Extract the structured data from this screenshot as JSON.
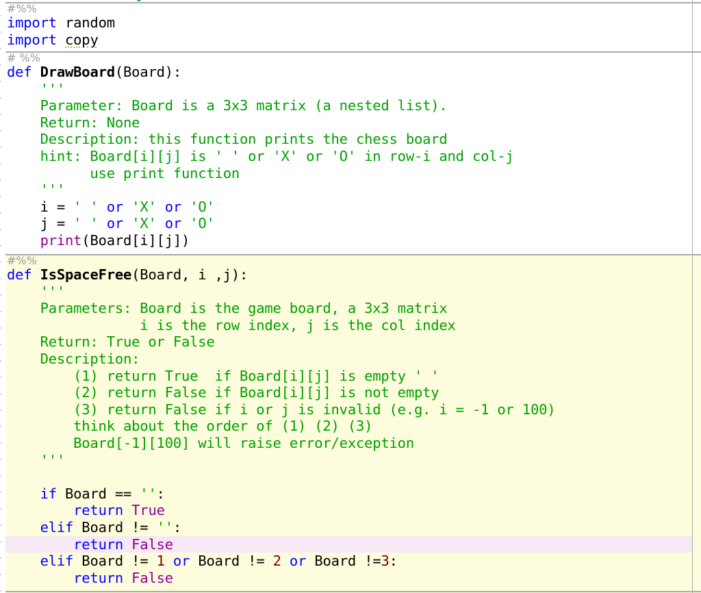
{
  "editor": {
    "language": "python",
    "cells": [
      {
        "id": "cell-imports",
        "active": false,
        "marker": "#%%",
        "lines": [
          [
            {
              "t": "kw",
              "v": "import"
            },
            {
              "t": "plain",
              "v": " random"
            }
          ],
          [
            {
              "t": "kw",
              "v": "import"
            },
            {
              "t": "plain",
              "v": " "
            },
            {
              "t": "squiggle",
              "v": "copy"
            }
          ]
        ]
      },
      {
        "id": "cell-drawboard",
        "active": false,
        "marker": "# %%",
        "lines": [
          [
            {
              "t": "kw",
              "v": "def"
            },
            {
              "t": "plain",
              "v": " "
            },
            {
              "t": "fn",
              "v": "DrawBoard"
            },
            {
              "t": "plain",
              "v": "(Board):"
            }
          ],
          [
            {
              "t": "doc",
              "v": "    '''"
            }
          ],
          [
            {
              "t": "doc",
              "v": "    Parameter: Board is a 3x3 matrix (a nested list)."
            }
          ],
          [
            {
              "t": "doc",
              "v": "    Return: None"
            }
          ],
          [
            {
              "t": "doc",
              "v": "    Description: this function prints the chess board"
            }
          ],
          [
            {
              "t": "doc",
              "v": "    hint: Board[i][j] is ' ' or 'X' or 'O' in row-i and col-j"
            }
          ],
          [
            {
              "t": "doc",
              "v": "          use print function"
            }
          ],
          [
            {
              "t": "doc",
              "v": "    '''"
            }
          ],
          [
            {
              "t": "plain",
              "v": "    i = "
            },
            {
              "t": "str",
              "v": "' '"
            },
            {
              "t": "plain",
              "v": " "
            },
            {
              "t": "kw",
              "v": "or"
            },
            {
              "t": "plain",
              "v": " "
            },
            {
              "t": "str",
              "v": "'X'"
            },
            {
              "t": "plain",
              "v": " "
            },
            {
              "t": "kw",
              "v": "or"
            },
            {
              "t": "plain",
              "v": " "
            },
            {
              "t": "str",
              "v": "'O'"
            }
          ],
          [
            {
              "t": "plain",
              "v": "    j = "
            },
            {
              "t": "str",
              "v": "' '"
            },
            {
              "t": "plain",
              "v": " "
            },
            {
              "t": "kw",
              "v": "or"
            },
            {
              "t": "plain",
              "v": " "
            },
            {
              "t": "str",
              "v": "'X'"
            },
            {
              "t": "plain",
              "v": " "
            },
            {
              "t": "kw",
              "v": "or"
            },
            {
              "t": "plain",
              "v": " "
            },
            {
              "t": "str",
              "v": "'O'"
            }
          ],
          [
            {
              "t": "plain",
              "v": "    "
            },
            {
              "t": "bi",
              "v": "print"
            },
            {
              "t": "plain",
              "v": "(Board[i][j])"
            }
          ]
        ]
      },
      {
        "id": "cell-isspacefree",
        "active": true,
        "marker": "#%%",
        "lines": [
          [
            {
              "t": "kw",
              "v": "def"
            },
            {
              "t": "plain",
              "v": " "
            },
            {
              "t": "fn",
              "v": "IsSpaceFree"
            },
            {
              "t": "plain",
              "v": "(Board, i ,j):"
            }
          ],
          [
            {
              "t": "doc",
              "v": "    '''"
            }
          ],
          [
            {
              "t": "doc",
              "v": "    Parameters: Board is the game board, a 3x3 matrix"
            }
          ],
          [
            {
              "t": "doc",
              "v": "                i is the row index, j is the col index"
            }
          ],
          [
            {
              "t": "doc",
              "v": "    Return: True or False"
            }
          ],
          [
            {
              "t": "doc",
              "v": "    Description:"
            }
          ],
          [
            {
              "t": "doc",
              "v": "        (1) return True  if Board[i][j] is empty ' '"
            }
          ],
          [
            {
              "t": "doc",
              "v": "        (2) return False if Board[i][j] is not empty"
            }
          ],
          [
            {
              "t": "doc",
              "v": "        (3) return False if i or j is invalid (e.g. i = -1 or 100)"
            }
          ],
          [
            {
              "t": "doc",
              "v": "        think about the order of (1) (2) (3)"
            }
          ],
          [
            {
              "t": "doc",
              "v": "        Board[-1][100] will raise error/exception"
            }
          ],
          [
            {
              "t": "doc",
              "v": "    '''"
            }
          ],
          [
            {
              "t": "plain",
              "v": ""
            }
          ],
          [
            {
              "t": "plain",
              "v": "    "
            },
            {
              "t": "kw",
              "v": "if"
            },
            {
              "t": "plain",
              "v": " Board == "
            },
            {
              "t": "str",
              "v": "''"
            },
            {
              "t": "plain",
              "v": ":"
            }
          ],
          [
            {
              "t": "plain",
              "v": "        "
            },
            {
              "t": "kw",
              "v": "return"
            },
            {
              "t": "plain",
              "v": " "
            },
            {
              "t": "bi",
              "v": "True"
            }
          ],
          [
            {
              "t": "plain",
              "v": "    "
            },
            {
              "t": "kw",
              "v": "elif"
            },
            {
              "t": "plain",
              "v": " Board != "
            },
            {
              "t": "str",
              "v": "''"
            },
            {
              "t": "plain",
              "v": ":"
            }
          ],
          [
            {
              "t": "plain",
              "v": "        "
            },
            {
              "t": "kw",
              "v": "return"
            },
            {
              "t": "plain",
              "v": " "
            },
            {
              "t": "bi",
              "v": "False"
            }
          ],
          [
            {
              "t": "plain",
              "v": "    "
            },
            {
              "t": "kw",
              "v": "elif"
            },
            {
              "t": "plain",
              "v": " Board != "
            },
            {
              "t": "num",
              "v": "1"
            },
            {
              "t": "plain",
              "v": " "
            },
            {
              "t": "kw",
              "v": "or"
            },
            {
              "t": "plain",
              "v": " Board != "
            },
            {
              "t": "num",
              "v": "2"
            },
            {
              "t": "plain",
              "v": " "
            },
            {
              "t": "kw",
              "v": "or"
            },
            {
              "t": "plain",
              "v": " Board !="
            },
            {
              "t": "num",
              "v": "3"
            },
            {
              "t": "plain",
              "v": ":"
            }
          ],
          [
            {
              "t": "plain",
              "v": "        "
            },
            {
              "t": "kw",
              "v": "return"
            },
            {
              "t": "plain",
              "v": " "
            },
            {
              "t": "bi",
              "v": "False"
            }
          ]
        ]
      }
    ],
    "current_line": {
      "cell": 2,
      "line": 16
    },
    "colors": {
      "keyword": "#0000ff",
      "string_docstring": "#00a000",
      "builtin": "#900090",
      "number": "#800000",
      "cell_marker": "#9a9a9a",
      "active_cell_bg": "#fdfcdc",
      "current_line_bg": "#f6e8f5",
      "divider": "#a9a9a9"
    }
  }
}
